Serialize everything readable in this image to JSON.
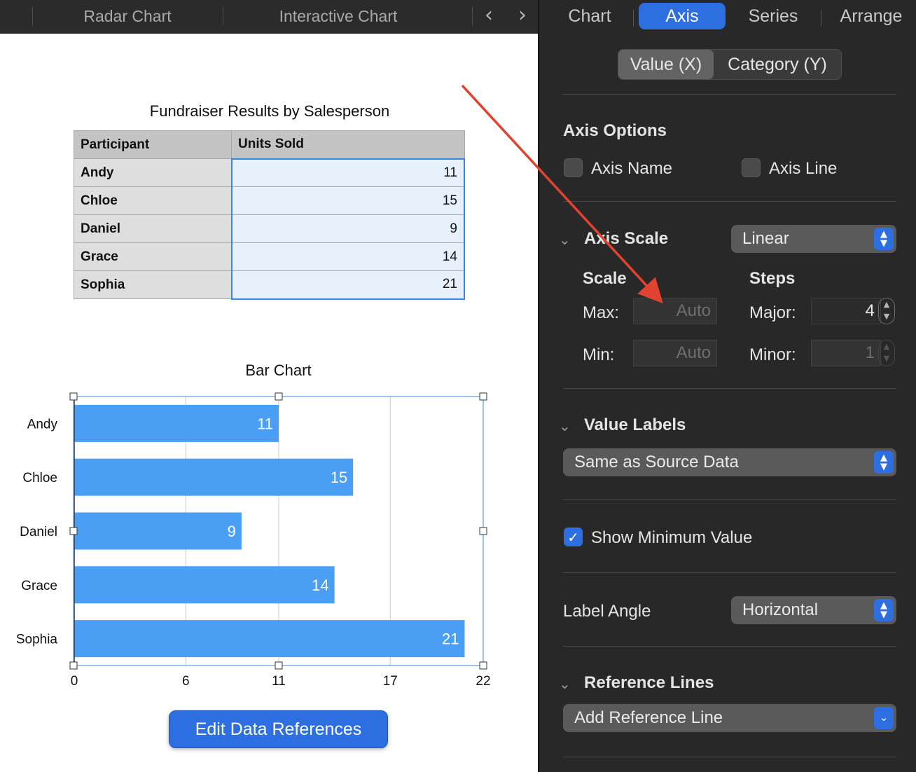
{
  "tabbar": {
    "tabs": [
      "Radar Chart",
      "Interactive Chart"
    ],
    "prev_arrow": "‹",
    "next_arrow": "›"
  },
  "table": {
    "title": "Fundraiser Results by Salesperson",
    "columns": [
      "Participant",
      "Units Sold"
    ],
    "rows": [
      {
        "name": "Andy",
        "value": "11"
      },
      {
        "name": "Chloe",
        "value": "15"
      },
      {
        "name": "Daniel",
        "value": "9"
      },
      {
        "name": "Grace",
        "value": "14"
      },
      {
        "name": "Sophia",
        "value": "21"
      }
    ]
  },
  "chart_data": {
    "type": "bar",
    "orientation": "horizontal",
    "title": "Bar Chart",
    "categories": [
      "Andy",
      "Chloe",
      "Daniel",
      "Grace",
      "Sophia"
    ],
    "values": [
      11,
      15,
      9,
      14,
      21
    ],
    "x_ticks": [
      0,
      6,
      11,
      17,
      22
    ],
    "xlim": [
      0,
      22
    ],
    "xlabel": "",
    "ylabel": "",
    "grid": "vertical",
    "data_labels": true,
    "bar_color": "#4a9ff5"
  },
  "edit_button": {
    "label": "Edit Data References"
  },
  "inspector": {
    "tabs": [
      {
        "label": "Chart",
        "active": false
      },
      {
        "label": "Axis",
        "active": true
      },
      {
        "label": "Series",
        "active": false
      },
      {
        "label": "Arrange",
        "active": false
      }
    ],
    "segments": [
      {
        "label": "Value (X)",
        "active": true
      },
      {
        "label": "Category (Y)",
        "active": false
      }
    ],
    "axis_options": {
      "heading": "Axis Options",
      "axis_name": {
        "label": "Axis Name",
        "checked": false
      },
      "axis_line": {
        "label": "Axis Line",
        "checked": false
      }
    },
    "axis_scale": {
      "heading": "Axis Scale",
      "selected": "Linear",
      "scale_heading": "Scale",
      "steps_heading": "Steps",
      "max_label": "Max:",
      "max_placeholder": "Auto",
      "min_label": "Min:",
      "min_placeholder": "Auto",
      "major_label": "Major:",
      "major_value": "4",
      "minor_label": "Minor:",
      "minor_value": "1"
    },
    "value_labels": {
      "heading": "Value Labels",
      "selected": "Same as Source Data"
    },
    "show_minimum": {
      "label": "Show Minimum Value",
      "checked": true
    },
    "label_angle": {
      "label": "Label Angle",
      "selected": "Horizontal"
    },
    "reference_lines": {
      "heading": "Reference Lines",
      "button": "Add Reference Line"
    }
  },
  "annotation": {
    "arrow_color": "#e0432f"
  },
  "colors": {
    "accent": "#2d6fe0",
    "panel_bg": "#282828"
  }
}
